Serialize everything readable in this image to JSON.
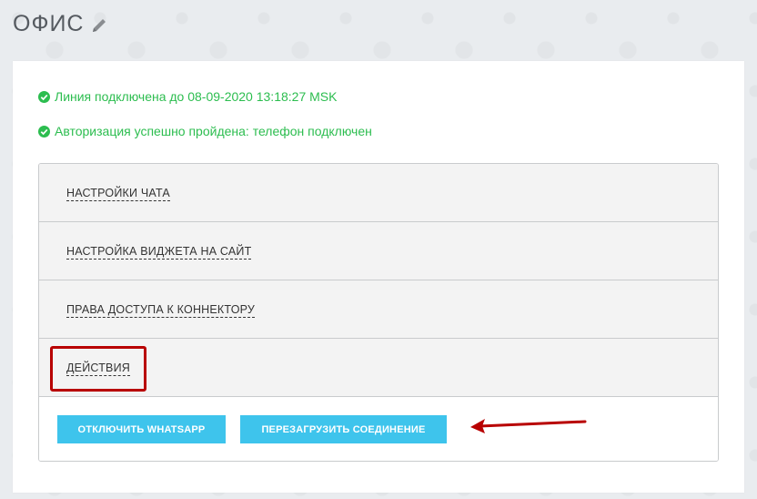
{
  "header": {
    "title": "ОФИС",
    "edit_icon": "pencil-icon"
  },
  "status": {
    "line1": "Линия подключена до 08-09-2020 13:18:27 MSK",
    "line2": "Авторизация успешно пройдена: телефон подключен",
    "color": "#2cbd4f"
  },
  "accordion": {
    "items": [
      {
        "label": "НАСТРОЙКИ ЧАТА"
      },
      {
        "label": "НАСТРОЙКА ВИДЖЕТА НА САЙТ"
      },
      {
        "label": "ПРАВА ДОСТУПА К КОННЕКТОРУ"
      },
      {
        "label": "ДЕЙСТВИЯ"
      }
    ]
  },
  "actions": {
    "disconnect_label": "ОТКЛЮЧИТЬ WHATSAPP",
    "reconnect_label": "ПЕРЕЗАГРУЗИТЬ СОЕДИНЕНИЕ",
    "button_color": "#3ec4ec"
  },
  "annotation": {
    "highlight_color": "#b80000"
  }
}
